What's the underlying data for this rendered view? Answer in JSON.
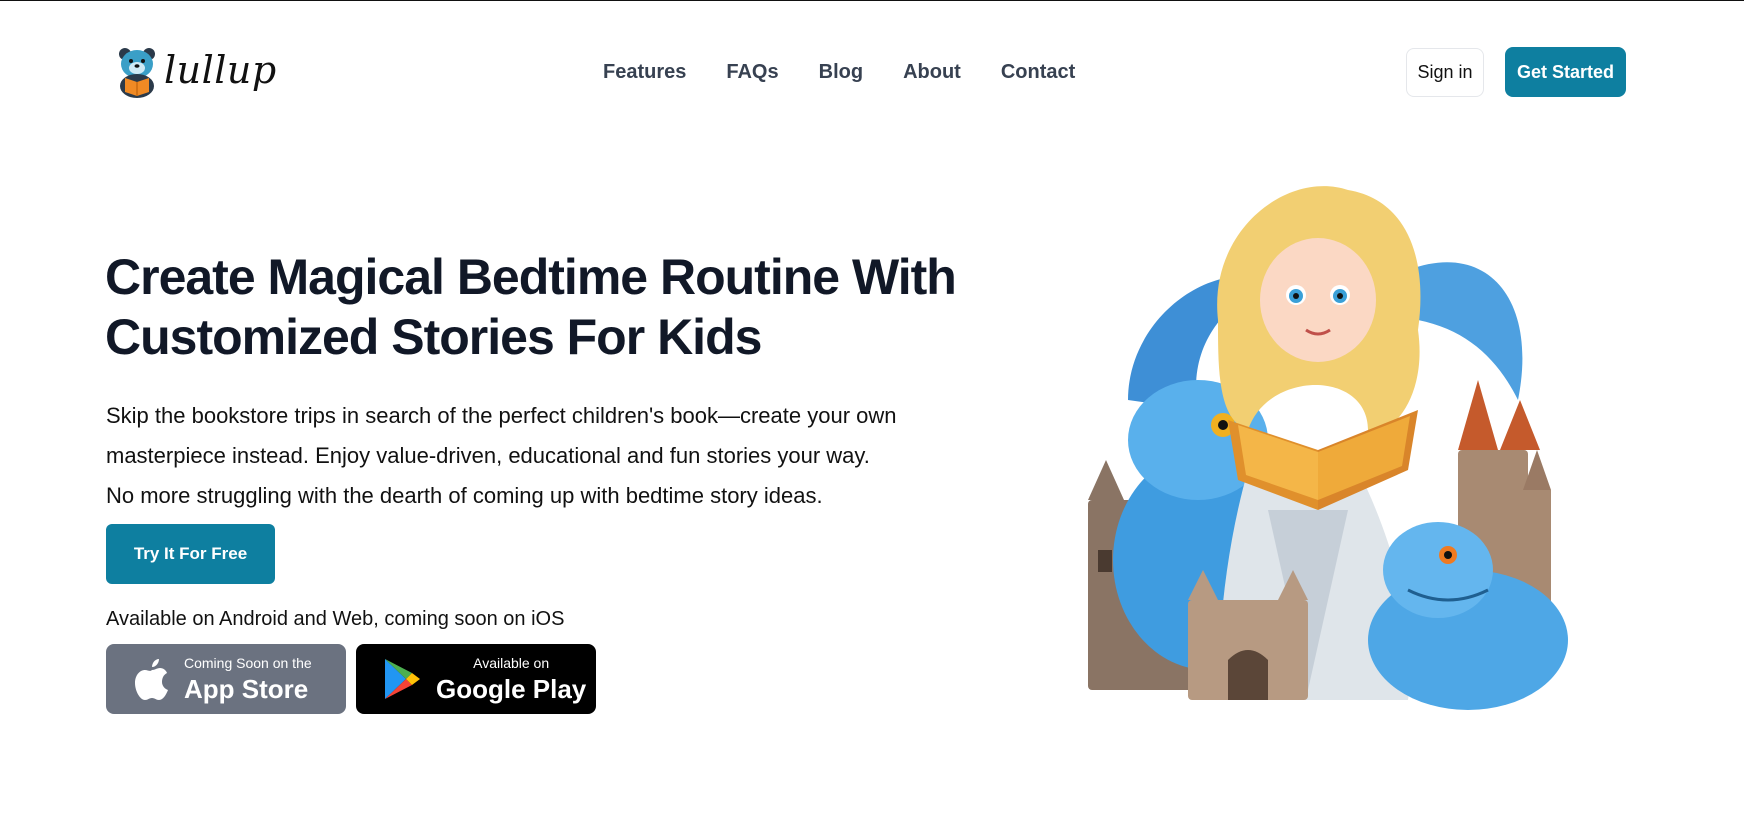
{
  "brand": {
    "name": "lullup",
    "logo_icon": "bear-reading-icon"
  },
  "nav": {
    "items": [
      {
        "label": "Features"
      },
      {
        "label": "FAQs"
      },
      {
        "label": "Blog"
      },
      {
        "label": "About"
      },
      {
        "label": "Contact"
      }
    ]
  },
  "header": {
    "signin_label": "Sign in",
    "get_started_label": "Get Started"
  },
  "hero": {
    "title": "Create Magical Bedtime Routine With Customized Stories For Kids",
    "description": [
      "Skip the bookstore trips in search of the perfect children's book—create your own",
      "masterpiece instead. Enjoy value-driven, educational and fun stories your way.",
      "No more struggling with the dearth of coming up with bedtime story ideas."
    ],
    "cta_label": "Try It For Free",
    "availability": "Available on Android and Web, coming soon on iOS"
  },
  "stores": {
    "apple": {
      "small": "Coming Soon on the",
      "big": "App Store",
      "icon": "apple-icon"
    },
    "google": {
      "small": "Available on",
      "big": "Google Play",
      "icon": "google-play-icon"
    }
  },
  "colors": {
    "accent": "#0e7fa0",
    "app_store_bg": "#6b7280",
    "google_play_bg": "#000000"
  }
}
